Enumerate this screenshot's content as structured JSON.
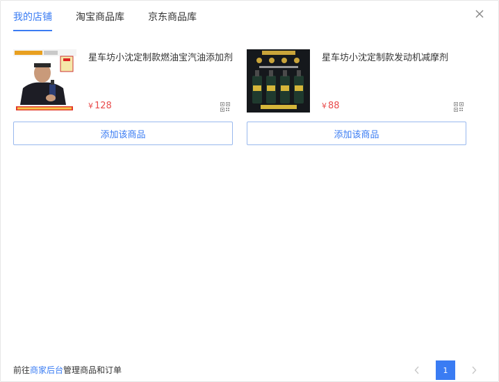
{
  "tabs": [
    {
      "label": "我的店铺",
      "active": true
    },
    {
      "label": "淘宝商品库",
      "active": false
    },
    {
      "label": "京东商品库",
      "active": false
    }
  ],
  "products": [
    {
      "name": "星车坊小沈定制款燃油宝汽油添加剂",
      "currency": "¥",
      "price": "128",
      "add_label": "添加该商品",
      "thumb_icon": "person-holding-bottle-image"
    },
    {
      "name": "星车坊小沈定制款发动机减摩剂",
      "currency": "¥",
      "price": "88",
      "add_label": "添加该商品",
      "thumb_icon": "four-bottles-image"
    }
  ],
  "footer": {
    "prefix": "前往",
    "link": "商家后台",
    "suffix": "管理商品和订单"
  },
  "pagination": {
    "current": "1"
  },
  "colors": {
    "accent": "#3a7cf3",
    "price": "#e94b4b",
    "border": "#98b8ee"
  }
}
